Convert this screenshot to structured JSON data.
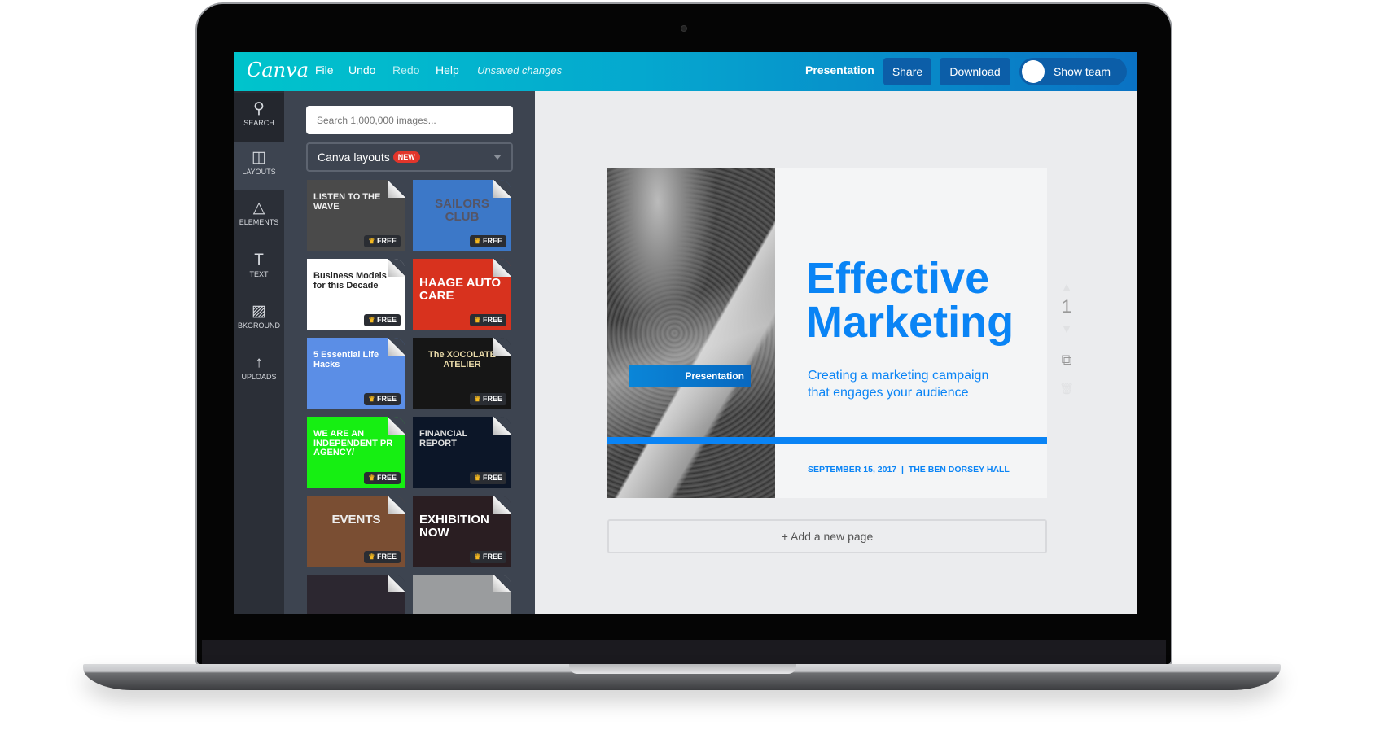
{
  "topbar": {
    "logo": "Canva",
    "menu": [
      "File",
      "Undo",
      "Redo",
      "Help"
    ],
    "status": "Unsaved changes",
    "doc_type": "Presentation",
    "share": "Share",
    "download": "Download",
    "show_team": "Show team",
    "gradient": [
      "#00c4cc",
      "#0a72c4"
    ]
  },
  "rail": [
    {
      "label": "SEARCH",
      "icon": "search-icon",
      "glyph": "⚲"
    },
    {
      "label": "LAYOUTS",
      "icon": "layouts-icon",
      "glyph": "◫",
      "active": true
    },
    {
      "label": "ELEMENTS",
      "icon": "shapes-icon",
      "glyph": "△"
    },
    {
      "label": "TEXT",
      "icon": "text-icon",
      "glyph": "T"
    },
    {
      "label": "BKGROUND",
      "icon": "background-icon",
      "glyph": "▨"
    },
    {
      "label": "UPLOADS",
      "icon": "upload-arrow-icon",
      "glyph": "↑"
    }
  ],
  "panel": {
    "search_placeholder": "Search 1,000,000 images...",
    "dropdown": "Canva layouts",
    "new_badge": "NEW",
    "free_label": "FREE",
    "templates": [
      {
        "text": "LISTEN TO THE WAVE",
        "bg": "#4a4a4a",
        "color": "#eee"
      },
      {
        "text": "SAILORS CLUB",
        "bg": "#3c78c8",
        "color": "#556"
      },
      {
        "text": "Business Models for this Decade",
        "bg": "#ffffff",
        "color": "#222"
      },
      {
        "text": "HAAGE AUTO CARE",
        "bg": "#d8321e",
        "color": "#fff"
      },
      {
        "text": "5 Essential Life Hacks",
        "bg": "#5b8ee6",
        "color": "#fff"
      },
      {
        "text": "The XOCOLATE ATELIER",
        "bg": "#161616",
        "color": "#e8d9a8"
      },
      {
        "text": "WE ARE AN INDEPENDENT PR AGENCY/",
        "bg": "#16ef12",
        "color": "#fff"
      },
      {
        "text": "FINANCIAL REPORT",
        "bg": "#0c1628",
        "color": "#ddd"
      },
      {
        "text": "EVENTS",
        "bg": "#7a4e33",
        "color": "#eee"
      },
      {
        "text": "EXHIBITION NOW",
        "bg": "#2a1e22",
        "color": "#fff"
      },
      {
        "text": "",
        "bg": "#2c2730",
        "color": "#fff"
      },
      {
        "text": "",
        "bg": "#9a9c9e",
        "color": "#fff"
      }
    ]
  },
  "slide": {
    "badge": "Presentation",
    "title_line1": "Effective",
    "title_line2": "Marketing",
    "subtitle_line1": "Creating a marketing campaign",
    "subtitle_line2": "that engages your audience",
    "date": "SEPTEMBER 15, 2017",
    "venue": "THE BEN DORSEY HALL",
    "separator": "|",
    "accent": "#0a84f5"
  },
  "page_controls": {
    "page_number": "1"
  },
  "add_page": "+ Add a new page"
}
